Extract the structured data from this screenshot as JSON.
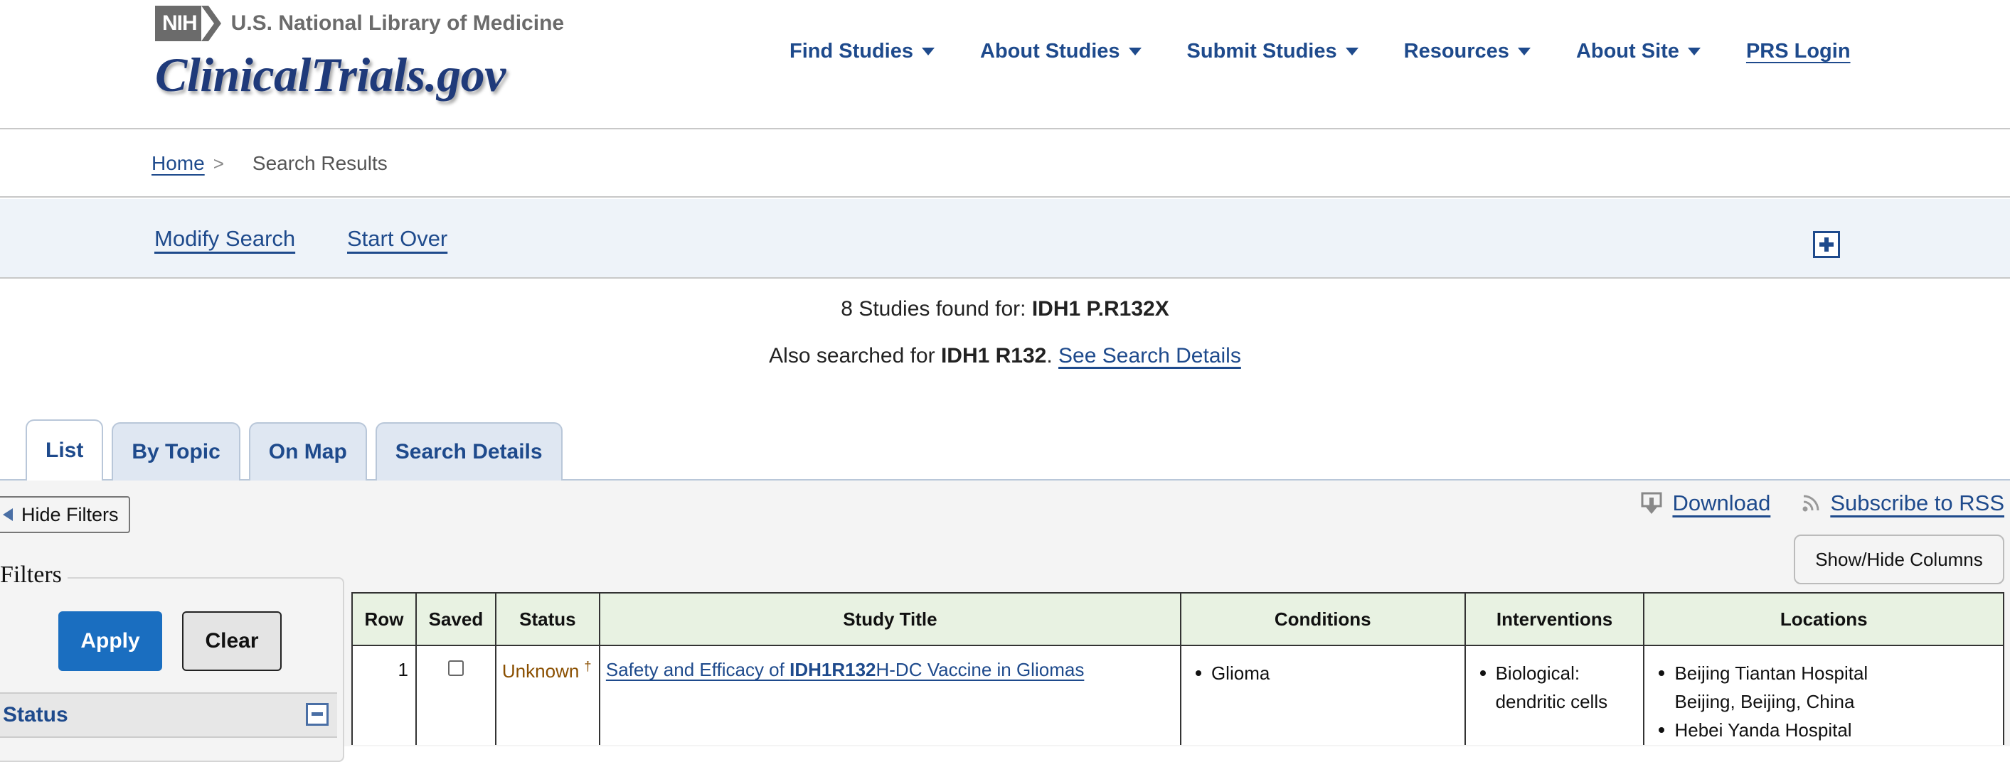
{
  "header": {
    "nih_badge": "NIH",
    "nlm_title": "U.S. National Library of Medicine",
    "brand": "ClinicalTrials.gov",
    "nav": [
      {
        "label": "Find Studies"
      },
      {
        "label": "About Studies"
      },
      {
        "label": "Submit Studies"
      },
      {
        "label": "Resources"
      },
      {
        "label": "About Site"
      }
    ],
    "prs_login": "PRS Login"
  },
  "breadcrumb": {
    "home": "Home",
    "separator": ">",
    "current": "Search Results"
  },
  "search_bar": {
    "modify": "Modify Search",
    "start_over": "Start Over"
  },
  "summary": {
    "count_text": "8 Studies found for: ",
    "query": "IDH1 P.R132X",
    "also_prefix": "Also searched for ",
    "also_term": "IDH1 R132",
    "also_suffix": ". ",
    "see_details": "See Search Details"
  },
  "tabs": [
    {
      "label": "List",
      "active": true
    },
    {
      "label": "By Topic"
    },
    {
      "label": "On Map"
    },
    {
      "label": "Search Details"
    }
  ],
  "toolbar": {
    "hide_filters": "Hide Filters",
    "download": "Download",
    "subscribe_rss": "Subscribe to RSS",
    "show_hide_columns": "Show/Hide Columns"
  },
  "filters": {
    "legend": "Filters",
    "apply": "Apply",
    "clear": "Clear",
    "status_section": "Status"
  },
  "table": {
    "columns": [
      "Row",
      "Saved",
      "Status",
      "Study Title",
      "Conditions",
      "Interventions",
      "Locations"
    ],
    "rows": [
      {
        "row": "1",
        "saved": false,
        "status": "Unknown",
        "status_marker": "†",
        "title_before": "Safety and Efficacy of ",
        "title_bold": "IDH1R132",
        "title_after": "H-DC Vaccine in Gliomas",
        "conditions": [
          "Glioma"
        ],
        "interventions": [
          "Biological:",
          "dendritic cells"
        ],
        "locations": [
          {
            "name": "Beijing Tiantan Hospital",
            "place": "Beijing, Beijing, China"
          },
          {
            "name": "Hebei Yanda Hospital",
            "place": ""
          }
        ]
      }
    ]
  },
  "colors": {
    "link_blue": "#1e4a8c",
    "apply_blue": "#1a6ec0",
    "header_green": "#e8f2e2",
    "status_unknown": "#8a4f00"
  }
}
